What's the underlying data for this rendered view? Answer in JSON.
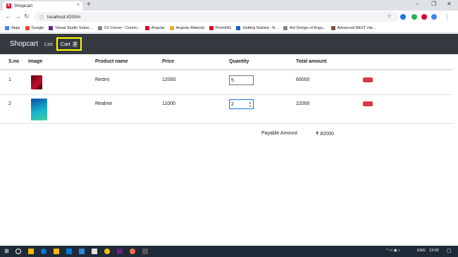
{
  "browser": {
    "tab_title": "Shopcart",
    "tab_close": "×",
    "new_tab": "+",
    "url": "localhost:4200/#",
    "win_min": "–",
    "win_max": "❐",
    "win_close": "✕"
  },
  "bookmarks": [
    {
      "label": "Apps",
      "color": "#4285f4"
    },
    {
      "label": "Google",
      "color": "#ea4335"
    },
    {
      "label": "Visual Studio Subsc...",
      "color": "#68217a"
    },
    {
      "label": "C# Corner - Comm...",
      "color": "#888888"
    },
    {
      "label": "Angular",
      "color": "#dd0031"
    },
    {
      "label": "Angular Material",
      "color": "#f9a825"
    },
    {
      "label": "PrimeNG",
      "color": "#dd0031"
    },
    {
      "label": "Getting Started - N...",
      "color": "#1565c0"
    },
    {
      "label": "Ant Design of Angu...",
      "color": "#888888"
    },
    {
      "label": "Advanced REST clie...",
      "color": "#795548"
    }
  ],
  "navbar": {
    "brand": "Shopcart",
    "list_label": "List",
    "cart_label": "Cart",
    "cart_count": "2"
  },
  "table": {
    "headers": {
      "sno": "S.no",
      "image": "Image",
      "name": "Product name",
      "price": "Price",
      "qty": "Quantity",
      "total": "Total amount"
    },
    "rows": [
      {
        "sno": "1",
        "name": "Redmi",
        "price": "12000",
        "qty": "5",
        "total": "60000"
      },
      {
        "sno": "2",
        "name": "Realme",
        "price": "11000",
        "qty": "2",
        "total": "22000"
      }
    ]
  },
  "summary": {
    "label": "Payable Amount",
    "amount": "₹ 82000"
  },
  "taskbar": {
    "lang": "ENG",
    "time": "13:05"
  },
  "colors": {
    "navbar": "#343a40",
    "highlight": "#ffff00",
    "danger": "#dc3545"
  }
}
